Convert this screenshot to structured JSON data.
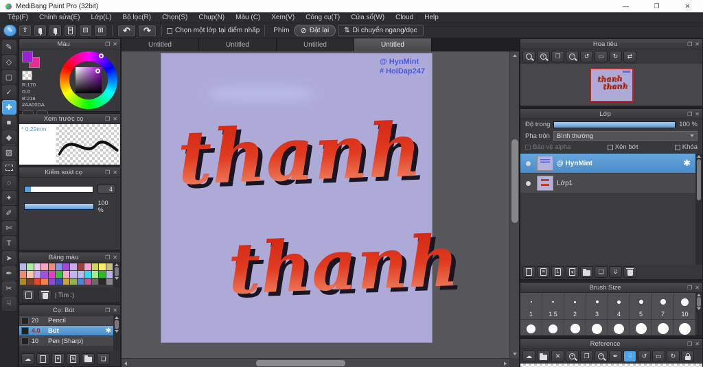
{
  "window": {
    "title": "MediBang Paint Pro (32bit)",
    "minimize": "—",
    "maximize": "❐",
    "close": "✕"
  },
  "glyphs": {
    "popout": "❐",
    "close": "✕",
    "reset_icon": "⊘",
    "move_icon": "⇅"
  },
  "menu_items": [
    "Tệp(F)",
    "Chỉnh sửa(E)",
    "Lớp(L)",
    "Bộ lọc(R)",
    "Chọn(S)",
    "Chụp(N)",
    "Màu (C)",
    "Xem(V)",
    "Công cụ(T)",
    "Cửa sổ(W)",
    "Cloud",
    "Help"
  ],
  "toolbar": {
    "main_icons": [
      {
        "name": "paint-mode-icon",
        "glyph": "✎",
        "active": true
      },
      {
        "name": "publish-icon",
        "glyph": "⇪"
      },
      {
        "name": "comment-icon",
        "css": "ci-bubble"
      },
      {
        "name": "comment-panel-icon",
        "css": "ci-bubble ci-bubble-wide"
      },
      {
        "name": "document-icon",
        "css": "ci-page",
        "glyph": "≡"
      },
      {
        "name": "material-list-icon",
        "glyph": "⊟"
      },
      {
        "name": "material-grid-icon",
        "glyph": "⊞"
      }
    ],
    "history_icons": [
      {
        "name": "undo-button",
        "glyph": "↶"
      },
      {
        "name": "redo-button",
        "glyph": "↷"
      }
    ],
    "select_layer_checkbox": "Chọn một lớp tại điểm nhấp",
    "key_label": "Phím",
    "reset_button": "Đặt lại",
    "move_button": "Di chuyển ngang/dọc"
  },
  "tool_strip": [
    {
      "name": "brush-tool",
      "glyph": "✎"
    },
    {
      "name": "eraser-tool",
      "glyph": "◇"
    },
    {
      "name": "shape-brush-tool",
      "glyph": "▢"
    },
    {
      "name": "snap-tool",
      "glyph": "✓"
    },
    {
      "name": "move-tool",
      "glyph": "✚",
      "active": true
    },
    {
      "name": "fill-rect-tool",
      "glyph": "■"
    },
    {
      "name": "bucket-tool",
      "glyph": "◆"
    },
    {
      "name": "gradient-tool",
      "glyph": "▧"
    },
    {
      "name": "select-tool",
      "css": "ci-dash"
    },
    {
      "name": "lasso-tool",
      "glyph": "◌"
    },
    {
      "name": "magic-wand-tool",
      "glyph": "✦"
    },
    {
      "name": "select-pen-tool",
      "glyph": "✐"
    },
    {
      "name": "select-eraser-tool",
      "glyph": "✄"
    },
    {
      "name": "text-tool",
      "glyph": "T"
    },
    {
      "name": "operation-tool",
      "glyph": "➤"
    },
    {
      "name": "eyedropper-tool",
      "glyph": "✒"
    },
    {
      "name": "divide-tool",
      "glyph": "✂"
    },
    {
      "name": "hand-tool",
      "glyph": "☟"
    }
  ],
  "document_tabs": [
    {
      "label": "Untitled"
    },
    {
      "label": "Untitled"
    },
    {
      "label": "Untitled"
    },
    {
      "label": "Untitled",
      "active": true
    }
  ],
  "canvas": {
    "credit_line1": "@ HynMint",
    "credit_line2": "# HoiDap247",
    "word_top": "thanh",
    "word_bottom": "thanh"
  },
  "colors": {
    "accent": "#4da3e8",
    "selection": "#5b9bd5",
    "canvas_bg": "#aeaad8",
    "credit": "#4a58e0",
    "nav_word": "#d23a22",
    "word_stops": [
      "#cf2310",
      "#e03a20",
      "#f49d78"
    ],
    "word_shadow": "#1a1520",
    "foreground": "#AA00DA",
    "background_swatch": "#E8288F"
  },
  "color_panel": {
    "title": "Màu",
    "r": "R:170",
    "g": "G:0",
    "b": "B:218",
    "hex": "#AA00DA"
  },
  "brush_preview_panel": {
    "title": "Xem trước cọ",
    "size": "* 0.29mm"
  },
  "brush_control_panel": {
    "title": "Kiểm soát cọ",
    "size_value": "4",
    "opacity_value": "100 %"
  },
  "palette_panel": {
    "title": "Bảng màu",
    "search": "| Tìm :)",
    "swatches": [
      "#b9b5ea",
      "#a9eea2",
      "#eec9ee",
      "#f7a3c3",
      "#ee8a78",
      "#8a92e2",
      "#a14ad8",
      "#c9aaea",
      "#a83b3b",
      "#f7a3d3",
      "#c9d862",
      "#f7ee62",
      "#c9c283",
      "#ee8a72",
      "#f7c9aa",
      "#c9aaf2",
      "#9a52ea",
      "#ea3aca",
      "#42ba42",
      "#f7aaca",
      "#c2b2f2",
      "#bab9ea",
      "#32daf2",
      "#aae98a",
      "#2aba2a",
      "#b9b5ea",
      "#b28a1a",
      "#7a422a",
      "#e24a2a",
      "#f2824a",
      "#8a4ad2",
      "#4249c2",
      "#caa242",
      "#92b252",
      "#4a86d2",
      "#c25292",
      "#6a6a6a",
      "#2a2a2a",
      "#888888"
    ]
  },
  "brush_list_panel": {
    "title": "Cọ: Bút",
    "brushes": [
      {
        "size": "20",
        "name": "Pencil"
      },
      {
        "size": "4.0",
        "name": "Bút",
        "selected": true,
        "gear": "✱"
      },
      {
        "size": "10",
        "name": "Pen (Sharp)"
      }
    ],
    "footer_icons": [
      {
        "name": "cloud-brush-icon",
        "glyph": "☁"
      },
      {
        "name": "add-brush-icon",
        "css": "ci-page"
      },
      {
        "name": "add-brush-menu-icon",
        "css": "ci-page",
        "glyph": "▾"
      },
      {
        "name": "script-brush-icon",
        "css": "ci-page",
        "glyph": "S"
      },
      {
        "name": "folder-icon",
        "css": "ci-folder"
      },
      {
        "name": "duplicate-brush-icon",
        "glyph": "❏"
      }
    ]
  },
  "navigator_panel": {
    "title": "Hoa tiêu",
    "icons": [
      {
        "name": "zoom-actual-icon",
        "css": "ci-mag"
      },
      {
        "name": "zoom-in-icon",
        "css": "ci-mag",
        "glyph": "+"
      },
      {
        "name": "fit-window-icon",
        "glyph": "❒"
      },
      {
        "name": "zoom-out-icon",
        "css": "ci-mag",
        "glyph": "−"
      },
      {
        "name": "rotate-left-icon",
        "glyph": "↺"
      },
      {
        "name": "rotate-reset-icon",
        "glyph": "▭"
      },
      {
        "name": "rotate-right-icon",
        "glyph": "↻"
      },
      {
        "name": "flip-icon",
        "glyph": "⇄"
      }
    ]
  },
  "layers_panel": {
    "title": "Lớp",
    "opacity_label": "Độ trong",
    "opacity_value": "100 %",
    "blend_label": "Pha trộn",
    "blend_mode": "Bình thường",
    "checkbox_alpha": "Bảo vệ alpha",
    "checkbox_clip": "Xén bớt",
    "checkbox_lock": "Khóa",
    "layers": [
      {
        "name": "@ HynMint",
        "selected": true,
        "thumb": "th-credit",
        "gear": "✱"
      },
      {
        "name": "Lớp1",
        "thumb": "th-word"
      }
    ],
    "footer_icons": [
      {
        "name": "add-layer-icon",
        "css": "ci-page"
      },
      {
        "name": "add-halftone-layer-icon",
        "css": "ci-page",
        "glyph": "≡"
      },
      {
        "name": "add-1bit-layer-icon",
        "css": "ci-page",
        "glyph": "1"
      },
      {
        "name": "add-layer-menu-icon",
        "css": "ci-page",
        "glyph": "▾"
      },
      {
        "name": "folder-icon",
        "css": "ci-folder"
      },
      {
        "name": "duplicate-layer-icon",
        "glyph": "❏"
      },
      {
        "name": "merge-layer-icon",
        "glyph": "⇓"
      },
      {
        "name": "delete-layer-icon",
        "css": "ci-trash"
      }
    ]
  },
  "brush_size_panel": {
    "title": "Brush Size",
    "sizes": [
      {
        "label": "1",
        "dot": 2
      },
      {
        "label": "1.5",
        "dot": 2.5
      },
      {
        "label": "2",
        "dot": 3
      },
      {
        "label": "3",
        "dot": 4
      },
      {
        "label": "4",
        "dot": 5
      },
      {
        "label": "5",
        "dot": 6
      },
      {
        "label": "7",
        "dot": 8
      },
      {
        "label": "10",
        "dot": 11
      }
    ],
    "sizes_row2": [
      {
        "dot": 13
      },
      {
        "dot": 13
      },
      {
        "dot": 14
      },
      {
        "dot": 15
      },
      {
        "dot": 15
      },
      {
        "dot": 16
      },
      {
        "dot": 16
      },
      {
        "dot": 17
      }
    ]
  },
  "reference_panel": {
    "title": "Reference",
    "icons": [
      {
        "name": "cloud-icon",
        "glyph": "☁"
      },
      {
        "name": "open-folder-icon",
        "css": "ci-folder"
      },
      {
        "name": "clear-icon",
        "glyph": "✕"
      },
      {
        "name": "zoom-in-icon",
        "css": "ci-mag",
        "glyph": "+"
      },
      {
        "name": "fit-window-icon",
        "glyph": "❒"
      },
      {
        "name": "zoom-out-icon",
        "css": "ci-mag",
        "glyph": "−"
      },
      {
        "name": "eyedropper-icon",
        "glyph": "✒"
      },
      {
        "name": "hand-icon",
        "glyph": "☟",
        "active": true
      },
      {
        "name": "rotate-left-icon",
        "glyph": "↺"
      },
      {
        "name": "rotate-reset-icon",
        "glyph": "▭"
      },
      {
        "name": "rotate-right-icon",
        "glyph": "↻"
      },
      {
        "name": "lock-icon",
        "css": "ci-lock"
      }
    ]
  }
}
